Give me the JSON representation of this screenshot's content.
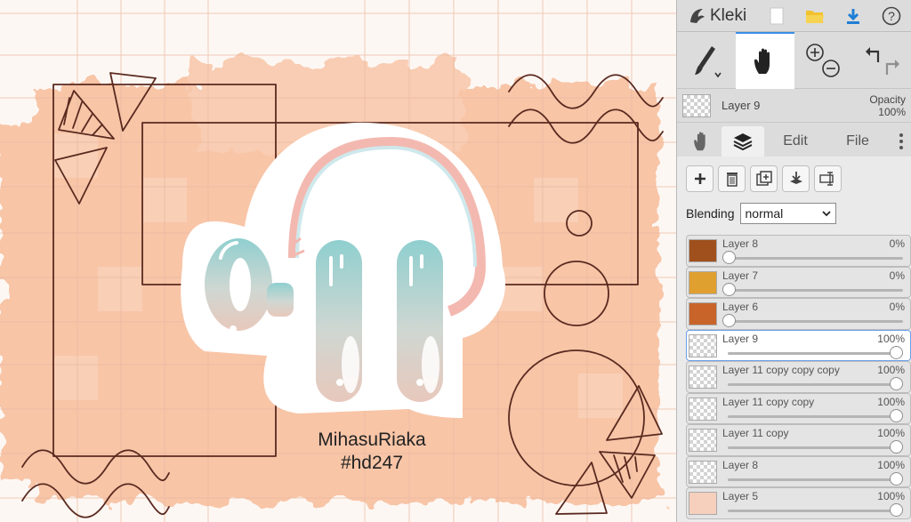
{
  "app": {
    "name": "Kleki"
  },
  "canvas": {
    "signature_line1": "MihasuRiaka",
    "signature_line2": "#hd247"
  },
  "current_layer": {
    "name": "Layer 9",
    "opacity_label": "Opacity",
    "opacity_value": "100%"
  },
  "tabs": [
    {
      "label": "Edit"
    },
    {
      "label": "File"
    }
  ],
  "blending": {
    "label": "Blending",
    "value": "normal"
  },
  "layers": [
    {
      "name": "Layer 8",
      "opacity": "0%",
      "value": 0,
      "thumb": "#a0501c"
    },
    {
      "name": "Layer 7",
      "opacity": "0%",
      "value": 0,
      "thumb": "#e0a030"
    },
    {
      "name": "Layer 6",
      "opacity": "0%",
      "value": 0,
      "thumb": "#c8642a"
    },
    {
      "name": "Layer 9",
      "opacity": "100%",
      "value": 100,
      "thumb": "checker",
      "active": true
    },
    {
      "name": "Layer 11 copy copy copy",
      "opacity": "100%",
      "value": 100,
      "thumb": "checker"
    },
    {
      "name": "Layer 11 copy copy",
      "opacity": "100%",
      "value": 100,
      "thumb": "checker"
    },
    {
      "name": "Layer 11 copy",
      "opacity": "100%",
      "value": 100,
      "thumb": "checker"
    },
    {
      "name": "Layer 8",
      "opacity": "100%",
      "value": 100,
      "thumb": "checker"
    },
    {
      "name": "Layer 5",
      "opacity": "100%",
      "value": 100,
      "thumb": "#f6d0bc"
    }
  ],
  "colors": {
    "accent": "#3a8ee6",
    "canvas_peach": "#f6b894",
    "outline_brown": "#5a2a20"
  },
  "icons": [
    "kleki-logo-icon",
    "new-file-icon",
    "open-folder-icon",
    "download-icon",
    "help-icon",
    "brush-icon",
    "hand-icon",
    "zoom-in-icon",
    "zoom-out-icon",
    "undo-icon",
    "redo-icon",
    "layers-icon",
    "menu-dots-icon",
    "add-layer-icon",
    "delete-layer-icon",
    "duplicate-layer-icon",
    "merge-down-icon",
    "rename-layer-icon"
  ]
}
